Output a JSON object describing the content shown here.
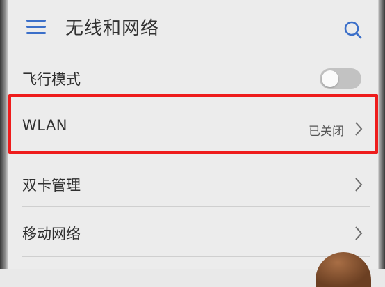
{
  "header": {
    "title": "无线和网络",
    "menu_icon": "hamburger-menu-icon",
    "search_icon": "search-icon"
  },
  "settings": {
    "airplane": {
      "label": "飞行模式",
      "toggle_on": false
    },
    "wlan": {
      "label": "WLAN",
      "status": "已关闭",
      "highlighted": true
    },
    "dual_sim": {
      "label": "双卡管理"
    },
    "mobile_network": {
      "label": "移动网络"
    }
  },
  "colors": {
    "accent": "#3b6fc9",
    "highlight_border": "#ee1c1c",
    "toggle_off": "#c2c2c2",
    "background": "#ececec"
  }
}
